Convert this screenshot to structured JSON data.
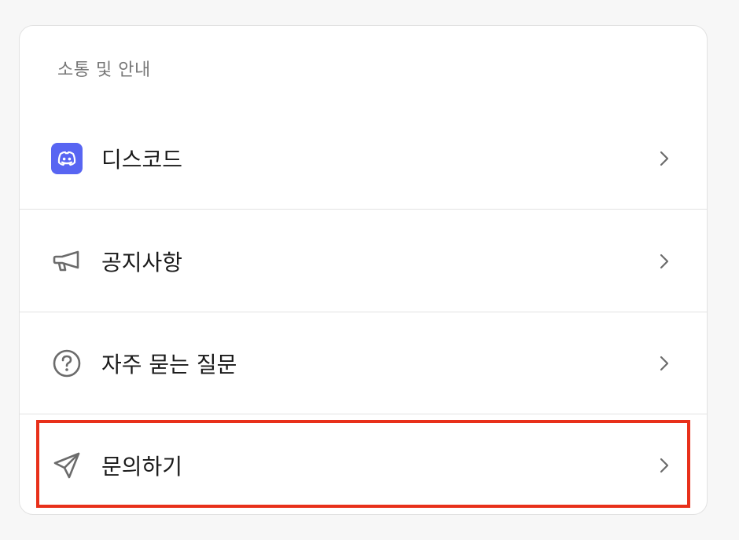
{
  "section": {
    "title": "소통 및 안내"
  },
  "items": [
    {
      "label": "디스코드",
      "icon": "discord-icon"
    },
    {
      "label": "공지사항",
      "icon": "megaphone-icon"
    },
    {
      "label": "자주 묻는 질문",
      "icon": "question-circle-icon"
    },
    {
      "label": "문의하기",
      "icon": "send-icon"
    }
  ],
  "colors": {
    "discord_brand": "#5865f2",
    "highlight": "#e8301a",
    "icon_gray": "#6b6b6b"
  }
}
